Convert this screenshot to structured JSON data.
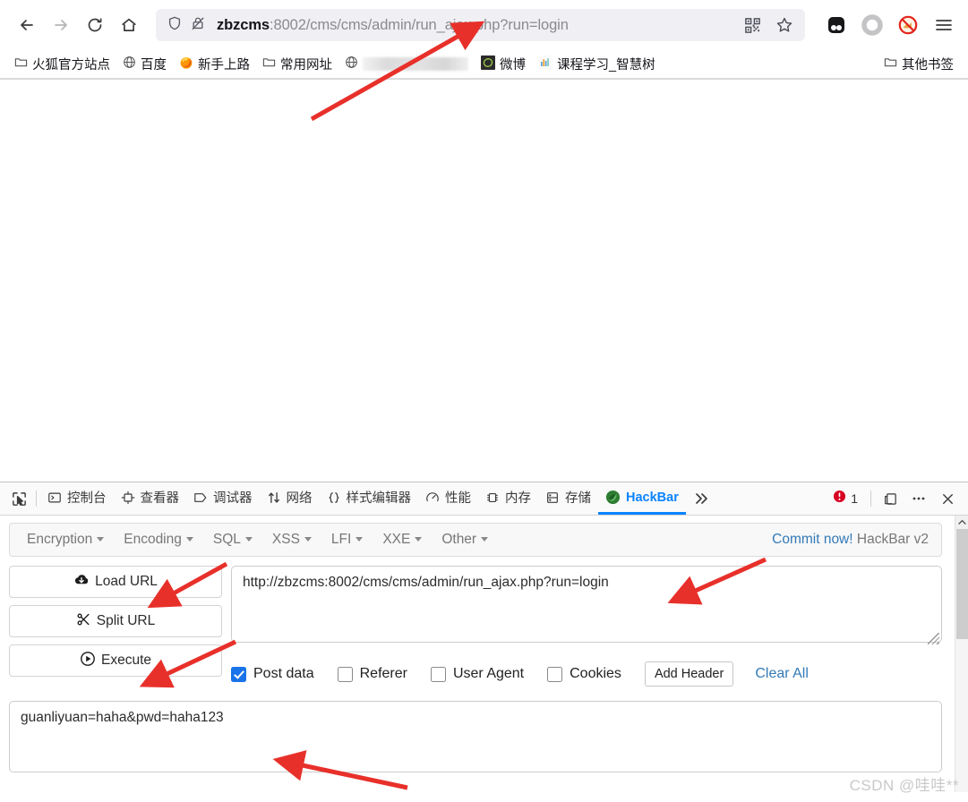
{
  "browser": {
    "nav_buttons": [
      {
        "name": "back",
        "icon": "arrow-left-icon"
      },
      {
        "name": "forward",
        "icon": "arrow-right-icon"
      },
      {
        "name": "reload",
        "icon": "reload-icon"
      },
      {
        "name": "home",
        "icon": "home-icon"
      }
    ],
    "urlbar": {
      "shield_icon": "shield-icon",
      "lock_broken_icon": "lock-broken-icon",
      "host": "zbzcms",
      "path": ":8002/cms/cms/admin/run_ajax.php?run=login",
      "full_url": "zbzcms:8002/cms/cms/admin/run_ajax.php?run=login",
      "qr_icon": "qr-code-icon",
      "bookmark_icon": "star-icon"
    },
    "extensions": [
      {
        "name": "extension-dark-icon"
      },
      {
        "name": "extension-circle-icon"
      },
      {
        "name": "adblock-icon"
      }
    ],
    "menu_icon": "hamburger-menu-icon",
    "bookmarks": [
      {
        "label": "火狐官方站点",
        "icon": "folder-icon"
      },
      {
        "label": "百度",
        "icon": "globe-icon"
      },
      {
        "label": "新手上路",
        "icon": "firefox-icon"
      },
      {
        "label": "常用网址",
        "icon": "folder-icon"
      },
      {
        "label": "",
        "icon": "globe-icon",
        "blurred": true
      },
      {
        "label": "微博",
        "icon": "weibo-icon"
      },
      {
        "label": "课程学习_智慧树",
        "icon": "zhihuishu-icon"
      }
    ],
    "other_bookmarks": {
      "label": "其他书签",
      "icon": "folder-icon"
    }
  },
  "devtools": {
    "picker_icon": "element-picker-icon",
    "tabs": [
      {
        "label": "控制台",
        "icon": "console-icon",
        "active": false
      },
      {
        "label": "查看器",
        "icon": "inspector-icon",
        "active": false
      },
      {
        "label": "调试器",
        "icon": "debugger-icon",
        "active": false
      },
      {
        "label": "网络",
        "icon": "network-icon",
        "active": false
      },
      {
        "label": "样式编辑器",
        "icon": "style-editor-icon",
        "active": false
      },
      {
        "label": "性能",
        "icon": "performance-icon",
        "active": false
      },
      {
        "label": "内存",
        "icon": "memory-icon",
        "active": false
      },
      {
        "label": "存储",
        "icon": "storage-icon",
        "active": false
      },
      {
        "label": "HackBar",
        "icon": "hackbar-icon",
        "active": true
      }
    ],
    "overflow_icon": "chevron-double-right-icon",
    "error_badge": {
      "icon": "error-icon",
      "count": "1"
    },
    "dock_icon": "dock-layout-icon",
    "more_icon": "more-options-icon",
    "close_icon": "close-icon"
  },
  "hackbar": {
    "menus": [
      {
        "label": "Encryption"
      },
      {
        "label": "Encoding"
      },
      {
        "label": "SQL"
      },
      {
        "label": "XSS"
      },
      {
        "label": "LFI"
      },
      {
        "label": "XXE"
      },
      {
        "label": "Other"
      }
    ],
    "commit_link": "Commit now!",
    "version": "HackBar v2",
    "buttons": [
      {
        "label": "Load URL",
        "icon": "cloud-download-icon"
      },
      {
        "label": "Split URL",
        "icon": "scissors-icon"
      },
      {
        "label": "Execute",
        "icon": "play-circle-icon"
      }
    ],
    "url_value": "http://zbzcms:8002/cms/cms/admin/run_ajax.php?run=login",
    "url_placeholder": "",
    "options": [
      {
        "label": "Post data",
        "checked": true
      },
      {
        "label": "Referer",
        "checked": false
      },
      {
        "label": "User Agent",
        "checked": false
      },
      {
        "label": "Cookies",
        "checked": false
      }
    ],
    "add_header_label": "Add Header",
    "clear_all_label": "Clear All",
    "post_data_value": "guanliyuan=haha&pwd=haha123",
    "post_data_placeholder": ""
  },
  "watermark": "CSDN @哇哇**",
  "colors": {
    "accent_blue": "#0a84ff",
    "link_blue": "#337ab7",
    "checkbox_blue": "#1a73e8",
    "arrow_red": "#e8302a",
    "urlbar_bg": "#f0f0f4",
    "panel_bg": "#f8f8f8"
  },
  "annotations": [
    {
      "name": "arrow-to-urlbar"
    },
    {
      "name": "arrow-to-load-url"
    },
    {
      "name": "arrow-to-execute"
    },
    {
      "name": "arrow-to-url-textarea"
    },
    {
      "name": "arrow-to-post-data"
    }
  ]
}
